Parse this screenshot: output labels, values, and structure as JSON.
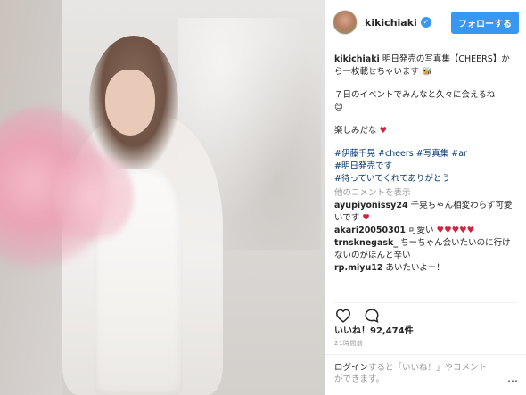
{
  "post": {
    "username": "kikichiaki",
    "follow_label": "フォローする",
    "caption": {
      "username": "kikichiaki",
      "line1": "明日発売の写真集【CHEERS】か",
      "line2": "ら一枚載せちゃいます",
      "line3": "７日のイベントでみんなと久々に会えるね",
      "line4": "楽しみだな",
      "tags1": "#伊藤千晃 #cheers #写真集 #ar",
      "tags2": "#明日発売です",
      "tags3": "#待っていてくれてありがとう"
    },
    "more_comments_label": "他のコメントを表示",
    "comments": [
      {
        "user": "ayupiyonissy24",
        "text": "千晃ちゃん相変わらず可愛いです"
      },
      {
        "user": "akari20050301",
        "text": "可愛い"
      },
      {
        "user": "trnsknegask_",
        "text": "ちーちゃん会いたいのに行けないのがほんと辛い"
      },
      {
        "user": "rp.miyu12",
        "text": "あいたいよー！"
      }
    ],
    "likes_label": "いいね！92,474件",
    "time_ago": "21時間前",
    "login_prompt": {
      "login_link": "ログイン",
      "middle": "すると「いいね！」やコメント",
      "end": "ができます。"
    },
    "more_options": "…"
  },
  "colors": {
    "accent": "#3897f0",
    "heart": "#d0233f",
    "hashtag": "#003569"
  }
}
